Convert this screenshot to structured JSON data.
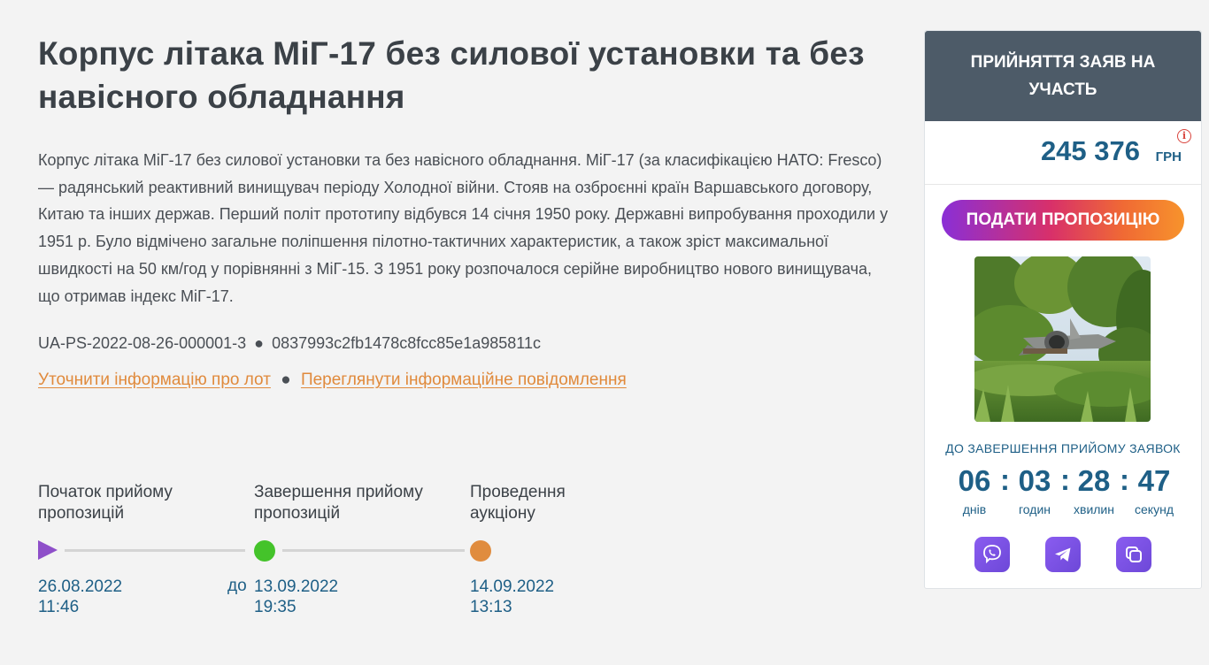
{
  "lot": {
    "title": "Корпус літака МіГ-17 без силової установки та без навісного обладнання",
    "description": "Корпус літака МіГ-17 без силової установки та без навісного обладнання. МіГ-17 (за класифікацією НАТО: Fresco) — радянський реактивний винищувач періоду Холодної війни. Стояв на озброєнні країн Варшавського договору, Китаю та інших держав. Перший політ прототипу відбувся 14 січня 1950 року. Державні випробування проходили у 1951 р. Було відмічено загальне поліпшення пілотно-тактичних характеристик, а також зріст максимальної швидкості на 50 км/год у порівнянні з МіГ-15. З 1951 року розпочалося серійне виробництво нового винищувача, що отримав індекс МіГ-17.",
    "id": "UA-PS-2022-08-26-000001-3",
    "hash": "0837993c2fb1478c8fcc85e1a985811c",
    "separator": "●"
  },
  "links": {
    "clarify": "Уточнити інформацію про лот",
    "view_notice": "Переглянути інформаційне повідомлення"
  },
  "timeline": {
    "start_label": "Початок прийому пропозицій",
    "start_date": "26.08.2022",
    "start_time": "11:46",
    "end_label": "Завершення прийому пропозицій",
    "end_prefix": "до",
    "end_date": "13.09.2022",
    "end_time": "19:35",
    "auction_label": "Проведення аукціону",
    "auction_date": "14.09.2022",
    "auction_time": "13:13",
    "colors": {
      "start": "#8e4fc9",
      "end": "#44c32a",
      "auction": "#e08c3e"
    }
  },
  "sidebar": {
    "status": "ПРИЙНЯТТЯ ЗАЯВ НА УЧАСТЬ",
    "price": "245 376",
    "currency": "ГРН",
    "info_icon": "info-icon",
    "bid_button": "ПОДАТИ ПРОПОЗИЦІЮ",
    "photo_icon": "aircraft-photo",
    "countdown_title": "ДО ЗАВЕРШЕННЯ ПРИЙОМУ ЗАЯВОК",
    "countdown": {
      "days": "06",
      "hours": "03",
      "minutes": "28",
      "seconds": "47",
      "separator": ":",
      "days_label": "днів",
      "hours_label": "годин",
      "minutes_label": "хвилин",
      "seconds_label": "секунд"
    },
    "share": [
      "viber-icon",
      "telegram-icon",
      "copy-icon"
    ]
  }
}
